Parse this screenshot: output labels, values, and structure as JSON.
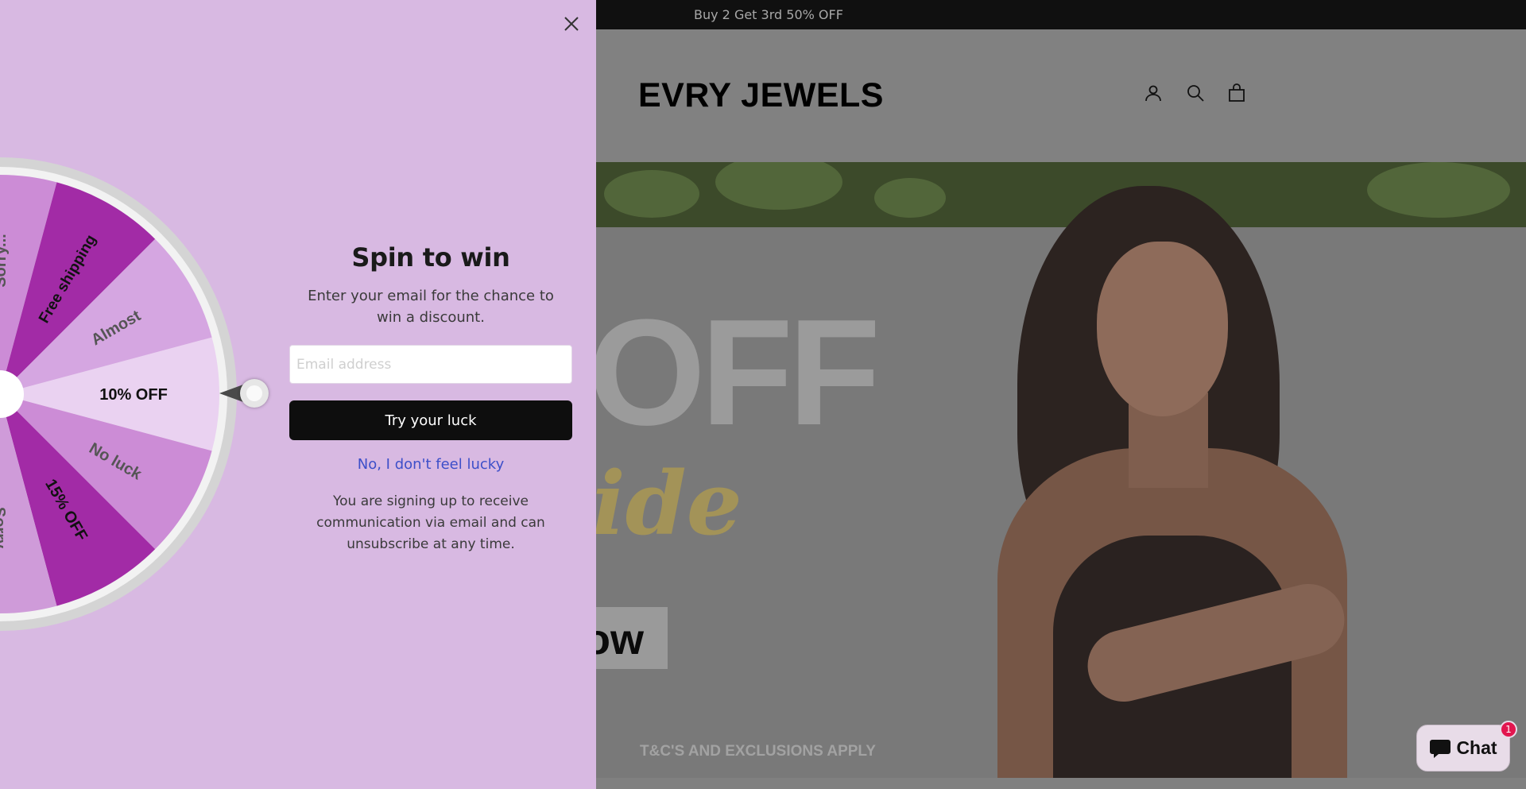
{
  "announcement": {
    "text": "Buy 2 Get 3rd 50% OFF"
  },
  "header": {
    "logo": "EVRY JEWELS",
    "icons": [
      "account-icon",
      "search-icon",
      "cart-icon"
    ]
  },
  "hero": {
    "headline": "OFF",
    "script_word": "ide",
    "cta_fragment": "ow",
    "terms": "T&C'S AND EXCLUSIONS APPLY"
  },
  "popup": {
    "title": "Spin to win",
    "subtitle": "Enter your email for the chance to win a discount.",
    "email_placeholder": "Email address",
    "email_value": "",
    "submit_label": "Try your luck",
    "decline_label": "No, I don't feel lucky",
    "disclaimer": "You are signing up to receive communication via email and can unsubscribe at any time.",
    "wheel": {
      "segments": [
        {
          "label": "10% OFF",
          "color": "#ead2f1",
          "text_color": "#111111"
        },
        {
          "label": "No luck",
          "color": "#cc8cd6",
          "text_color": "#555555"
        },
        {
          "label": "15% OFF",
          "color": "#a22ba6",
          "text_color": "#111111"
        },
        {
          "label": "Sorry",
          "color": "#cf9bd9",
          "text_color": "#555555"
        },
        {
          "label": "",
          "color": "#b54db9",
          "text_color": "#111111"
        },
        {
          "label": "",
          "color": "#d7aae0",
          "text_color": "#555555"
        },
        {
          "label": "",
          "color": "#a22ba6",
          "text_color": "#111111"
        },
        {
          "label": "",
          "color": "#d7aae0",
          "text_color": "#555555"
        },
        {
          "label": "",
          "color": "#b54db9",
          "text_color": "#111111"
        },
        {
          "label": "Sorry...",
          "color": "#cc8cd6",
          "text_color": "#555555"
        },
        {
          "label": "Free shipping",
          "color": "#a22ba6",
          "text_color": "#111111"
        },
        {
          "label": "Almost",
          "color": "#d5a6e1",
          "text_color": "#555555"
        }
      ]
    }
  },
  "chat": {
    "label": "Chat",
    "badge": "1"
  },
  "colors": {
    "popup_bg": "#d8b9e2",
    "button_bg": "#0e0e0e",
    "link": "#3d4fc9",
    "badge": "#e2164f"
  }
}
